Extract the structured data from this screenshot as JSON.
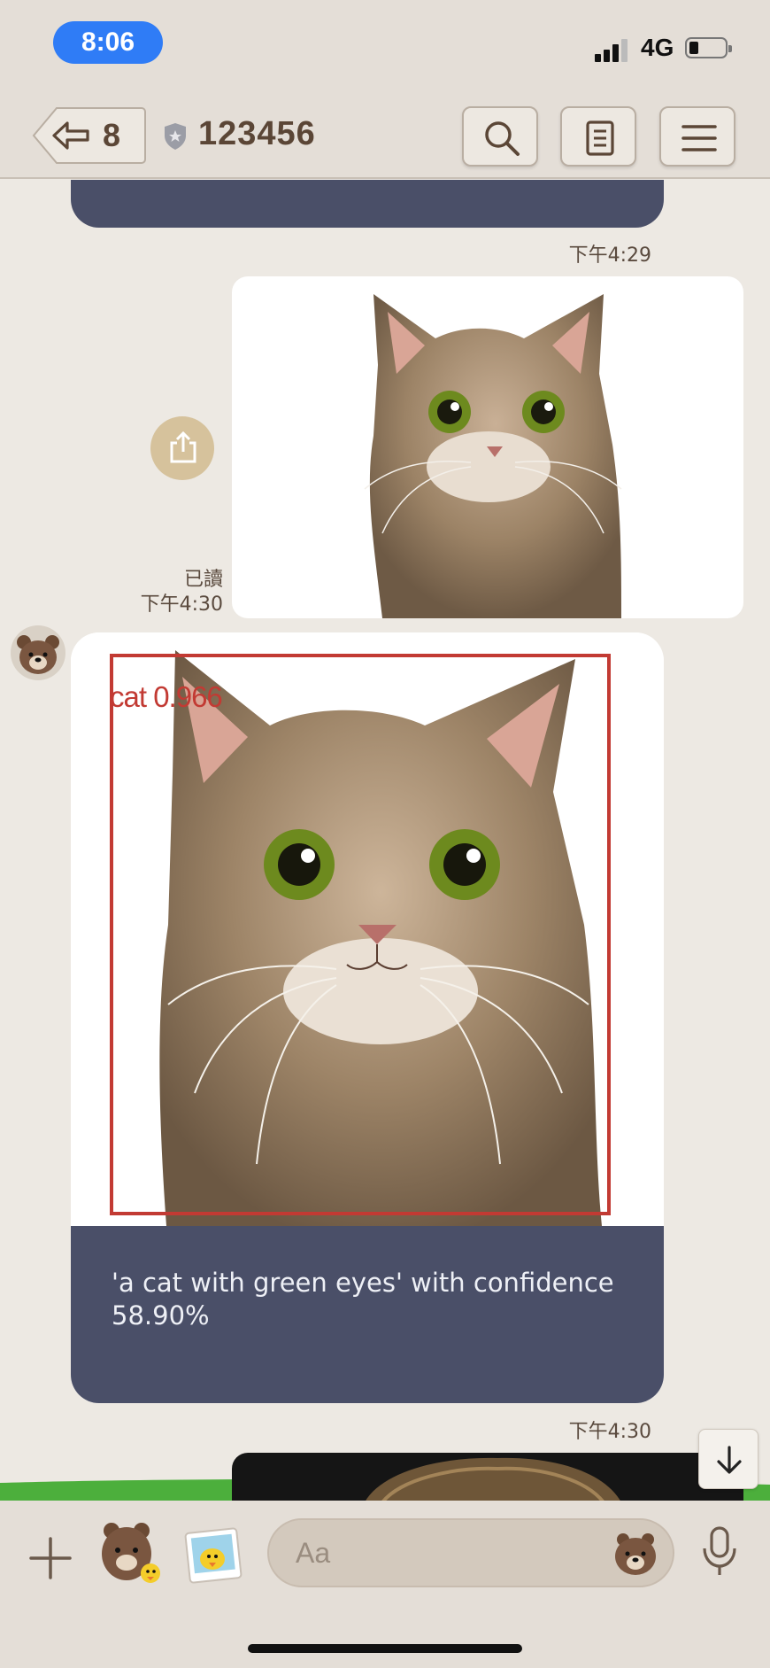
{
  "status_bar": {
    "time": "8:06",
    "network": "4G",
    "battery_level": 0.25
  },
  "header": {
    "back_count": "8",
    "chat_title": "123456",
    "icons": [
      "back-arrow-icon",
      "shield-icon",
      "search-icon",
      "notes-icon",
      "menu-icon"
    ]
  },
  "messages": {
    "m1_time": "下午4:29",
    "m2_read": "已讀",
    "m2_time": "下午4:30",
    "m3_detect_label": "cat 0.966",
    "m3_caption": "'a cat with green eyes' with confidence 58.90%",
    "m3_time": "下午4:30"
  },
  "input_bar": {
    "placeholder": "Aa",
    "icons": [
      "plus-icon",
      "sticker-icon",
      "photo-sticker-icon",
      "emoji-icon",
      "mic-icon"
    ]
  },
  "colors": {
    "time_pill": "#2f7cf6",
    "bubble_dark": "#4a4f68",
    "detect_box": "#c23a33",
    "background": "#ede9e3"
  }
}
